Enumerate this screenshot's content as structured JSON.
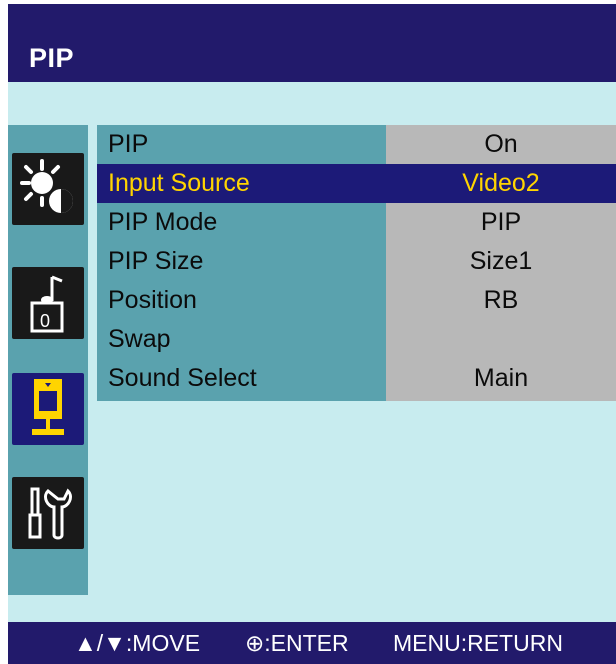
{
  "header": {
    "title": "PIP"
  },
  "sidebar": {
    "icons": [
      {
        "name": "picture-adjust-icon",
        "selected": false
      },
      {
        "name": "sound-icon",
        "selected": false
      },
      {
        "name": "pip-icon",
        "selected": true
      },
      {
        "name": "setup-tools-icon",
        "selected": false
      }
    ]
  },
  "menu": {
    "items": [
      {
        "label": "PIP",
        "value": "On"
      },
      {
        "label": "Input Source",
        "value": "Video2",
        "selected": true
      },
      {
        "label": "PIP Mode",
        "value": "PIP"
      },
      {
        "label": "PIP Size",
        "value": "Size1"
      },
      {
        "label": "Position",
        "value": "RB"
      },
      {
        "label": "Swap",
        "value": ""
      },
      {
        "label": "Sound Select",
        "value": "Main"
      }
    ]
  },
  "footer": {
    "move": "▲/▼:MOVE",
    "enter": "⊕:ENTER",
    "return": "MENU:RETURN"
  },
  "colors": {
    "title_bar": "#221a6b",
    "background": "#c8ecef",
    "menu_label_bg": "#5aa2ae",
    "menu_value_bg": "#b8b8b8",
    "highlight_bg": "#1c1a78",
    "highlight_text": "#ffd400"
  }
}
